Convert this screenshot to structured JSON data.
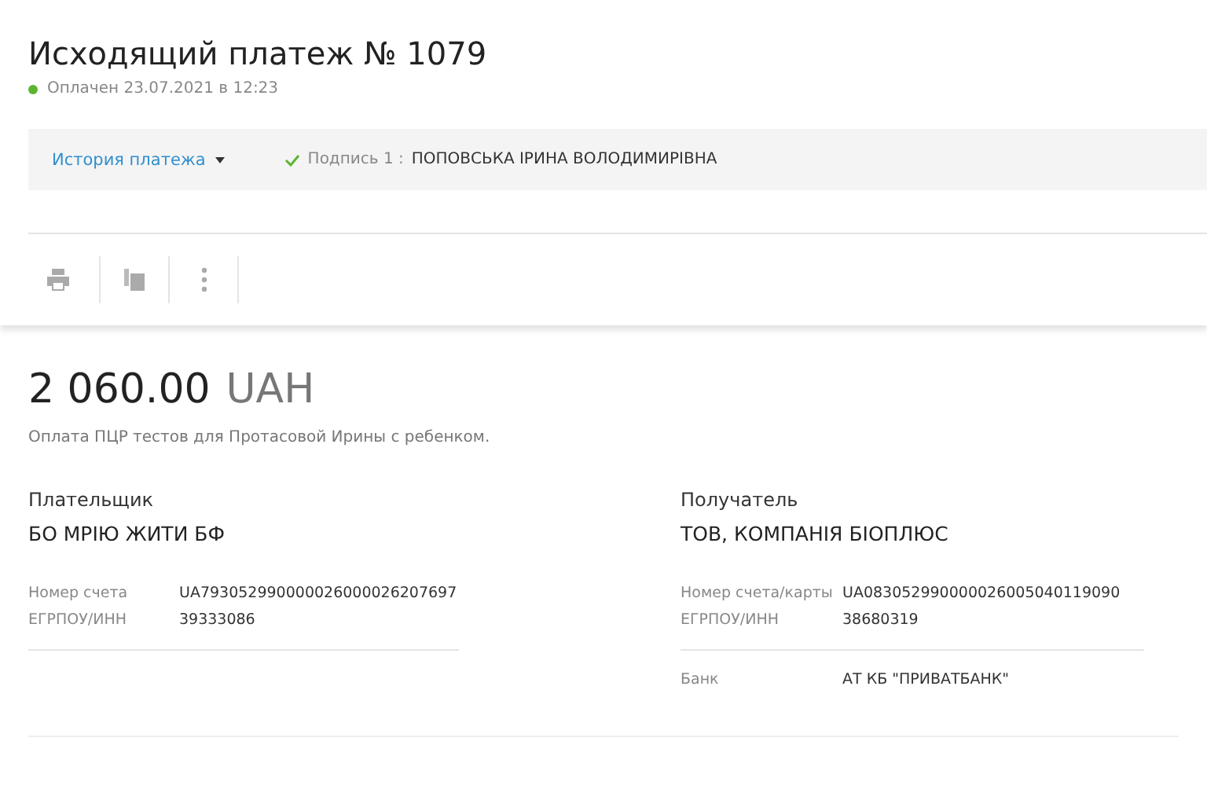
{
  "title": "Исходящий платеж № 1079",
  "status": {
    "text": "Оплачен 23.07.2021 в 12:23",
    "color": "#5cb531"
  },
  "history": {
    "label": "История платежа",
    "signature_label": "Подпись 1 :",
    "signer": "ПОПОВСЬКА ІРИНА ВОЛОДИМИРІВНА",
    "signed": true
  },
  "toolbar": [
    {
      "kind": "print"
    },
    {
      "kind": "copy"
    },
    {
      "kind": "more"
    }
  ],
  "amount": {
    "value": "2 060.00",
    "currency": "UAH"
  },
  "purpose": "Оплата ПЦР тестов для Протасовой Ирины с ребенком.",
  "parties": [
    {
      "heading": "Плательщик",
      "name": "БО МРІЮ ЖИТИ БФ",
      "rows": [
        {
          "label": "Номер счета",
          "value": "UA793052990000026000026207697"
        },
        {
          "label": "ЕГРПОУ/ИНН",
          "value": "39333086"
        }
      ]
    },
    {
      "heading": "Получатель",
      "name": "ТОВ, КОМПАНІЯ БІОПЛЮС",
      "rows": [
        {
          "label": "Номер счета/карты",
          "value": "UA083052990000026005040119090"
        },
        {
          "label": "ЕГРПОУ/ИНН",
          "value": "38680319"
        }
      ],
      "extra_rows": [
        {
          "label": "Банк",
          "value": "АТ КБ \"ПРИВАТБАНК\""
        }
      ]
    }
  ]
}
